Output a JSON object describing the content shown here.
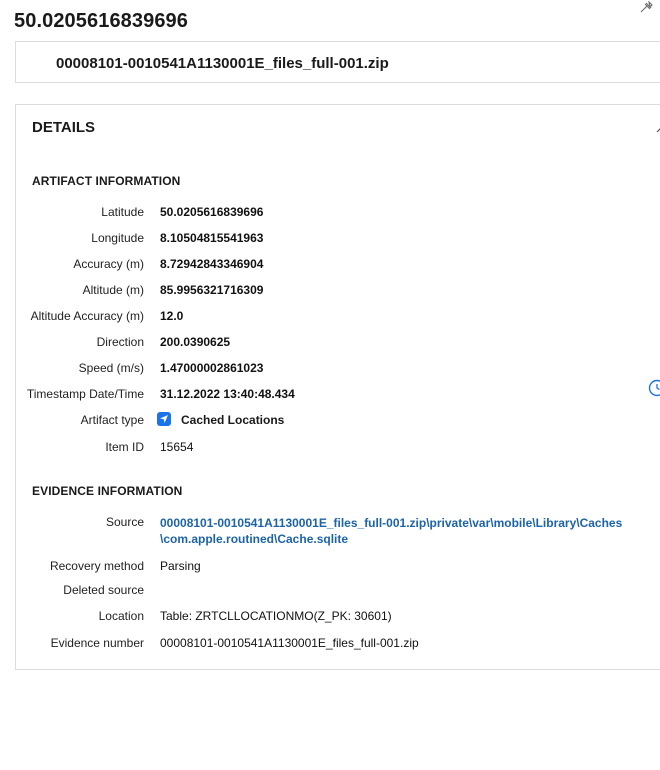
{
  "header": {
    "title": "50.0205616839696",
    "file_name": "00008101-0010541A1130001E_files_full-001.zip"
  },
  "details": {
    "heading": "DETAILS",
    "artifact_section": {
      "heading": "ARTIFACT INFORMATION",
      "rows": [
        {
          "label": "Latitude",
          "value": "50.0205616839696"
        },
        {
          "label": "Longitude",
          "value": "8.10504815541963"
        },
        {
          "label": "Accuracy (m)",
          "value": "8.72942843346904"
        },
        {
          "label": "Altitude (m)",
          "value": "85.9956321716309"
        },
        {
          "label": "Altitude Accuracy (m)",
          "value": "12.0"
        },
        {
          "label": "Direction",
          "value": "200.0390625"
        },
        {
          "label": "Speed (m/s)",
          "value": "1.47000002861023"
        },
        {
          "label": "Timestamp Date/Time",
          "value": "31.12.2022 13:40:48.434"
        },
        {
          "label": "Artifact type",
          "value": "Cached Locations",
          "icon": "location-arrow-icon"
        },
        {
          "label": "Item ID",
          "value": "15654"
        }
      ]
    },
    "evidence_section": {
      "heading": "EVIDENCE INFORMATION",
      "source": {
        "label": "Source",
        "line1": "00008101-0010541A1130001E_files_full-001.zip\\private\\var\\mobile\\Library\\Caches",
        "line2": "\\com.apple.routined\\Cache.sqlite"
      },
      "rows": [
        {
          "label": "Recovery method",
          "value": "Parsing"
        },
        {
          "label": "Deleted source",
          "value": ""
        },
        {
          "label": "Location",
          "value": "Table: ZRTCLLOCATIONMO(Z_PK: 30601)"
        },
        {
          "label": "Evidence number",
          "value": "00008101-0010541A1130001E_files_full-001.zip"
        }
      ]
    }
  },
  "colors": {
    "link": "#1d63a8",
    "accent": "#1a73e8",
    "border": "#dcdcdc"
  }
}
